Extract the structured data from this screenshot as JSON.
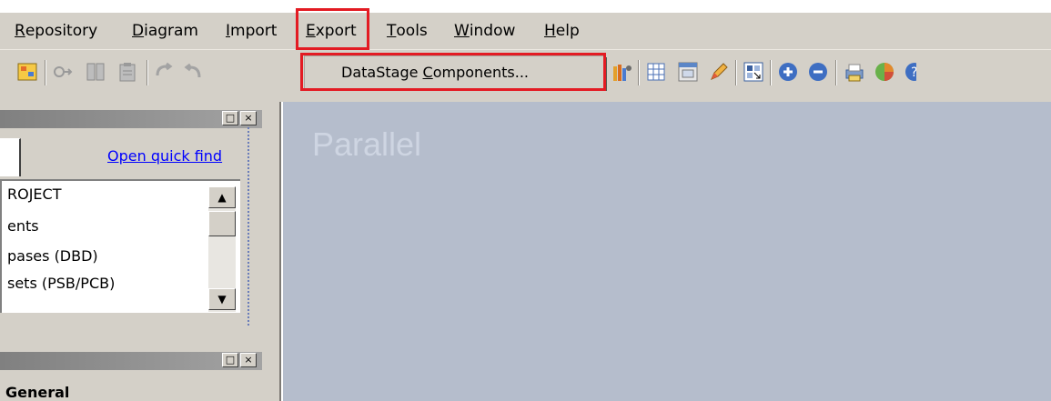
{
  "menubar": {
    "items": [
      {
        "label": "Repository",
        "mnemonic": "R",
        "rest": "epository"
      },
      {
        "label": "Diagram",
        "mnemonic": "D",
        "rest": "iagram"
      },
      {
        "label": "Import",
        "mnemonic": "I",
        "rest": "mport"
      },
      {
        "label": "Export",
        "mnemonic": "E",
        "rest": "xport"
      },
      {
        "label": "Tools",
        "mnemonic": "T",
        "rest": "ools"
      },
      {
        "label": "Window",
        "mnemonic": "W",
        "rest": "indow"
      },
      {
        "label": "Help",
        "mnemonic": "H",
        "rest": "elp"
      }
    ]
  },
  "dropdown": {
    "item_pre": "DataStage ",
    "item_mnemonic": "C",
    "item_post": "omponents..."
  },
  "left_panel": {
    "quick_find_link": "Open quick find",
    "tree_items": [
      "ROJECT",
      "ents",
      "pases (DBD)",
      "sets (PSB/PCB)"
    ],
    "bottom_panel_title": "General"
  },
  "canvas": {
    "title": "Parallel"
  },
  "colors": {
    "highlight_red": "#e31b23",
    "canvas_bg": "#b5bdcc",
    "link_blue": "#0000ff"
  },
  "icons": [
    "toolbar-grid-icon",
    "toolbar-link-icon",
    "toolbar-columns-icon",
    "toolbar-clipboard-icon",
    "toolbar-undo-icon",
    "toolbar-redo-icon",
    "toolbar-palette-icon",
    "toolbar-table-icon",
    "toolbar-window-icon",
    "toolbar-pencil-icon",
    "toolbar-layout-icon",
    "zoom-in-icon",
    "zoom-out-icon",
    "toolbar-print-icon",
    "pie-chart-icon",
    "help-icon"
  ]
}
